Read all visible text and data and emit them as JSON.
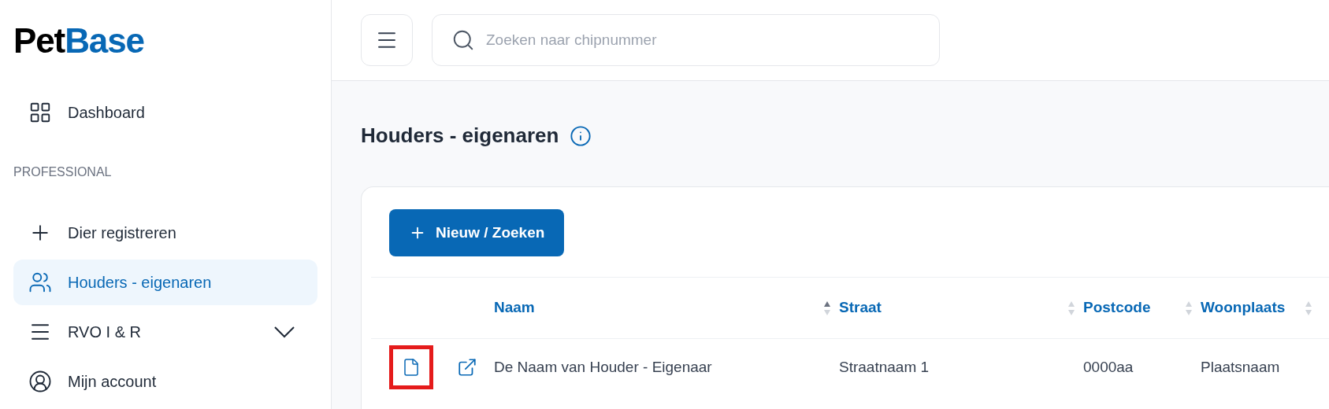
{
  "logo": {
    "dark": "Pet",
    "accent": "Base"
  },
  "sidebar": {
    "items": [
      {
        "kind": "link",
        "label": "Dashboard",
        "selected": false
      },
      {
        "kind": "section",
        "label": "PROFESSIONAL"
      },
      {
        "kind": "link",
        "label": "Dier registreren",
        "selected": false
      },
      {
        "kind": "link",
        "label": "Houders - eigenaren",
        "selected": true
      },
      {
        "kind": "group",
        "label": "RVO I & R",
        "selected": false,
        "expanded": false
      },
      {
        "kind": "link",
        "label": "Mijn account",
        "selected": false
      }
    ]
  },
  "search": {
    "placeholder": "Zoeken naar chipnummer"
  },
  "page": {
    "title": "Houders - eigenaren"
  },
  "new_button": {
    "label": "Nieuw / Zoeken"
  },
  "table": {
    "columns": [
      {
        "label": "Naam",
        "sorted": true
      },
      {
        "label": "Straat",
        "sorted": false
      },
      {
        "label": "Postcode",
        "sorted": false
      },
      {
        "label": "Woonplaats",
        "sorted": false
      }
    ],
    "rows": [
      {
        "cells": [
          "De Naam van Houder - Eigenaar",
          "Straatnaam 1",
          "0000aa",
          "Plaatsnaam"
        ],
        "document_highlighted": true
      }
    ]
  }
}
